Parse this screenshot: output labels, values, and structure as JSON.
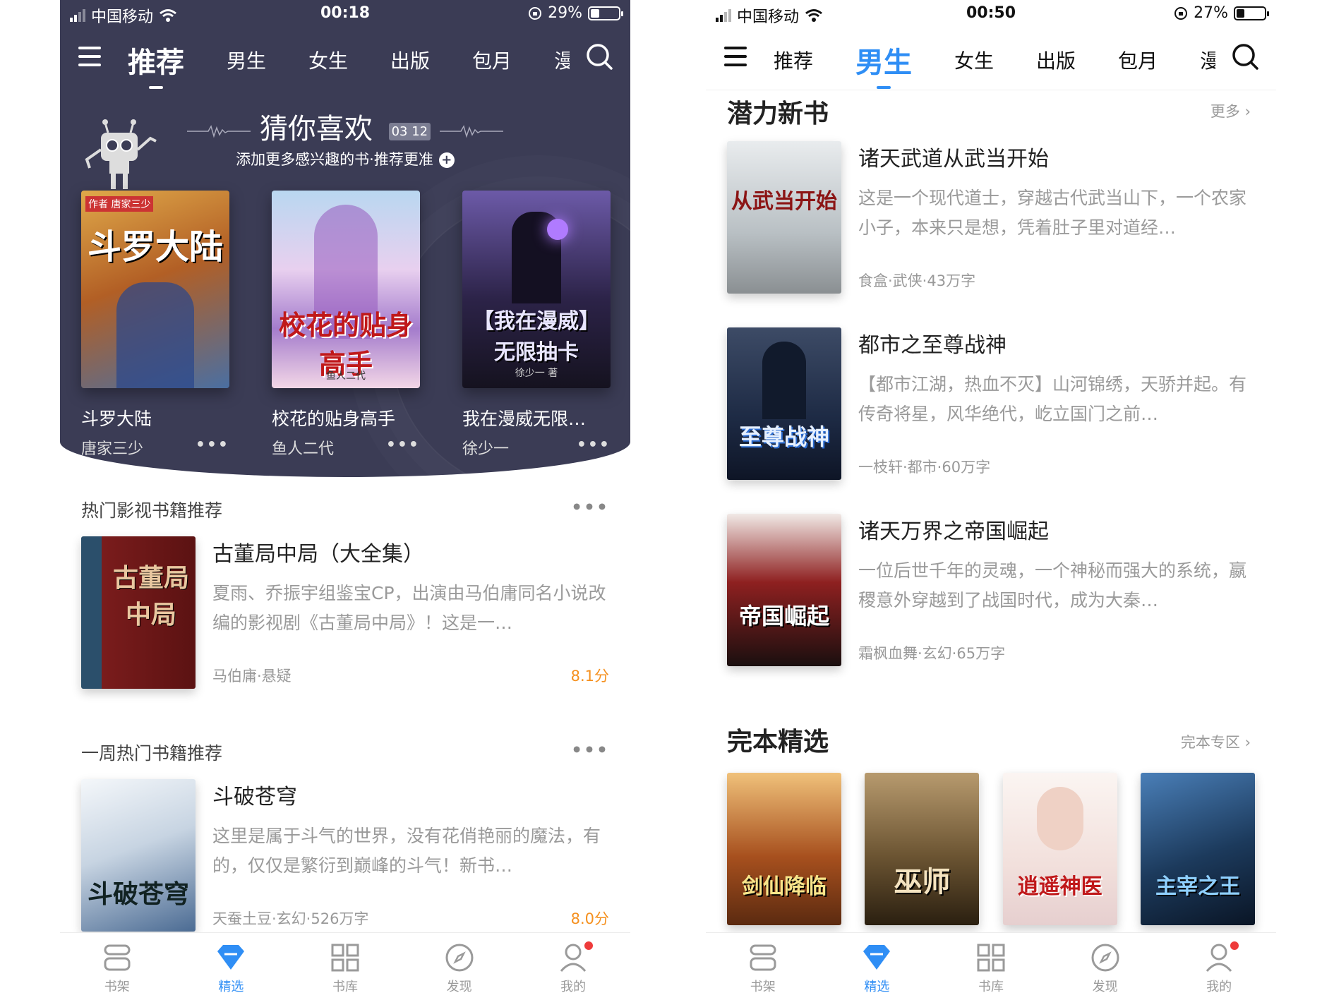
{
  "left": {
    "status": {
      "carrier": "中国移动",
      "time": "00:18",
      "battery": "29%",
      "battery_level": 0.29
    },
    "nav": {
      "tabs": [
        "推荐",
        "男生",
        "女生",
        "出版",
        "包月",
        "漫"
      ],
      "active": "推荐"
    },
    "guess": {
      "title": "猜你喜欢",
      "date_month": "03",
      "date_day": "12",
      "subtitle": "添加更多感兴趣的书·推荐更准",
      "books": [
        {
          "name": "斗罗大陆",
          "author": "唐家三少",
          "cover_title": "斗罗大陆",
          "cover_tag": "作者 唐家三少",
          "color": "#c77a2a"
        },
        {
          "name": "校花的贴身高手",
          "author": "鱼人二代",
          "cover_title": "校花的贴身高手",
          "cover_tag": "鱼人二代",
          "color": "#a47ccc"
        },
        {
          "name": "我在漫威无限…",
          "author": "徐少一",
          "cover_title": "【我在漫威】无限抽卡",
          "cover_tag": "徐少一 著",
          "color": "#3c2f6a"
        }
      ]
    },
    "section1": {
      "title": "热门影视书籍推荐",
      "book": {
        "title": "古董局中局（大全集）",
        "desc": "夏雨、乔振宇组鉴宝CP，出演由马伯庸同名小说改编的影视剧《古董局中局》！这是一…",
        "meta": "马伯庸·悬疑",
        "score": "8.1分",
        "cover_title": "古董局中局",
        "color": "#7a1c1c"
      }
    },
    "section2": {
      "title": "一周热门书籍推荐",
      "book": {
        "title": "斗破苍穹",
        "desc": "这里是属于斗气的世界，没有花俏艳丽的魔法，有的，仅仅是繁衍到巅峰的斗气！新书…",
        "meta": "天蚕土豆·玄幻·526万字",
        "score": "8.0分",
        "cover_title": "斗破苍穹",
        "color": "#dfe6ee"
      }
    },
    "tabbar": [
      {
        "label": "书架",
        "icon": "bookshelf-icon"
      },
      {
        "label": "精选",
        "icon": "diamond-icon",
        "active": true
      },
      {
        "label": "书库",
        "icon": "grid-icon"
      },
      {
        "label": "发现",
        "icon": "compass-icon"
      },
      {
        "label": "我的",
        "icon": "profile-icon",
        "badge": true
      }
    ]
  },
  "right": {
    "status": {
      "carrier": "中国移动",
      "time": "00:50",
      "battery": "27%",
      "battery_level": 0.27
    },
    "nav": {
      "tabs": [
        "推荐",
        "男生",
        "女生",
        "出版",
        "包月",
        "漫"
      ],
      "active": "男生"
    },
    "potential": {
      "title": "潜力新书",
      "more": "更多",
      "books": [
        {
          "title": "诸天武道从武当开始",
          "desc": "这是一个现代道士，穿越古代武当山下，一个农家小子，本来只是想，凭着肚子里对道经…",
          "meta": "食盒·武侠·43万字",
          "cover_title": "从武当开始",
          "color": "#cfd3d6"
        },
        {
          "title": "都市之至尊战神",
          "desc": "【都市江湖，热血不灭】山河锦绣，天骄并起。有传奇将星，风华绝代，屹立国门之前…",
          "meta": "一枝轩·都市·60万字",
          "cover_title": "至尊战神",
          "color": "#1d2a44"
        },
        {
          "title": "诸天万界之帝国崛起",
          "desc": "一位后世千年的灵魂，一个神秘而强大的系统，嬴稷意外穿越到了战国时代，成为大秦…",
          "meta": "霜枫血舞·玄幻·65万字",
          "cover_title": "帝国崛起",
          "color": "#2a1414"
        }
      ]
    },
    "complete": {
      "title": "完本精选",
      "more": "完本专区",
      "books": [
        {
          "cover_title": "剑仙降临",
          "color": "#a7501e"
        },
        {
          "cover_title": "巫师",
          "color": "#6b5432"
        },
        {
          "cover_title": "逍遥神医",
          "color": "#f2e8e4"
        },
        {
          "cover_title": "主宰之王",
          "color": "#1c3a5c"
        }
      ]
    },
    "tabbar": [
      {
        "label": "书架",
        "icon": "bookshelf-icon"
      },
      {
        "label": "精选",
        "icon": "diamond-icon",
        "active": true
      },
      {
        "label": "书库",
        "icon": "grid-icon"
      },
      {
        "label": "发现",
        "icon": "compass-icon"
      },
      {
        "label": "我的",
        "icon": "profile-icon",
        "badge": true
      }
    ]
  }
}
